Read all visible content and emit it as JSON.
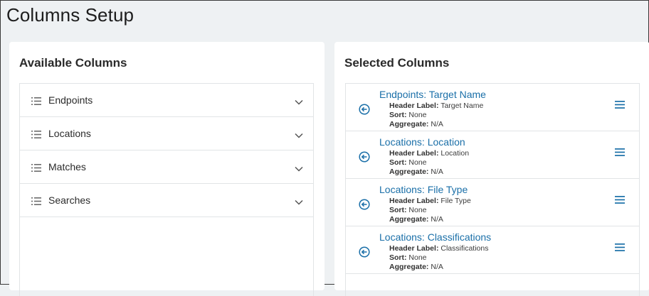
{
  "page": {
    "title": "Columns Setup"
  },
  "available": {
    "title": "Available Columns",
    "items": [
      {
        "label": "Endpoints"
      },
      {
        "label": "Locations"
      },
      {
        "label": "Matches"
      },
      {
        "label": "Searches"
      }
    ]
  },
  "selected": {
    "title": "Selected Columns",
    "labels": {
      "header": "Header Label:",
      "sort": "Sort:",
      "aggregate": "Aggregate:"
    },
    "items": [
      {
        "title": "Endpoints: Target Name",
        "header": "Target Name",
        "sort": "None",
        "aggregate": "N/A"
      },
      {
        "title": "Locations: Location",
        "header": "Location",
        "sort": "None",
        "aggregate": "N/A"
      },
      {
        "title": "Locations: File Type",
        "header": "File Type",
        "sort": "None",
        "aggregate": "N/A"
      },
      {
        "title": "Locations: Classifications",
        "header": "Classifications",
        "sort": "None",
        "aggregate": "N/A"
      }
    ]
  },
  "colors": {
    "accent": "#1a6fa8",
    "icon_gray": "#6b6b6b"
  }
}
